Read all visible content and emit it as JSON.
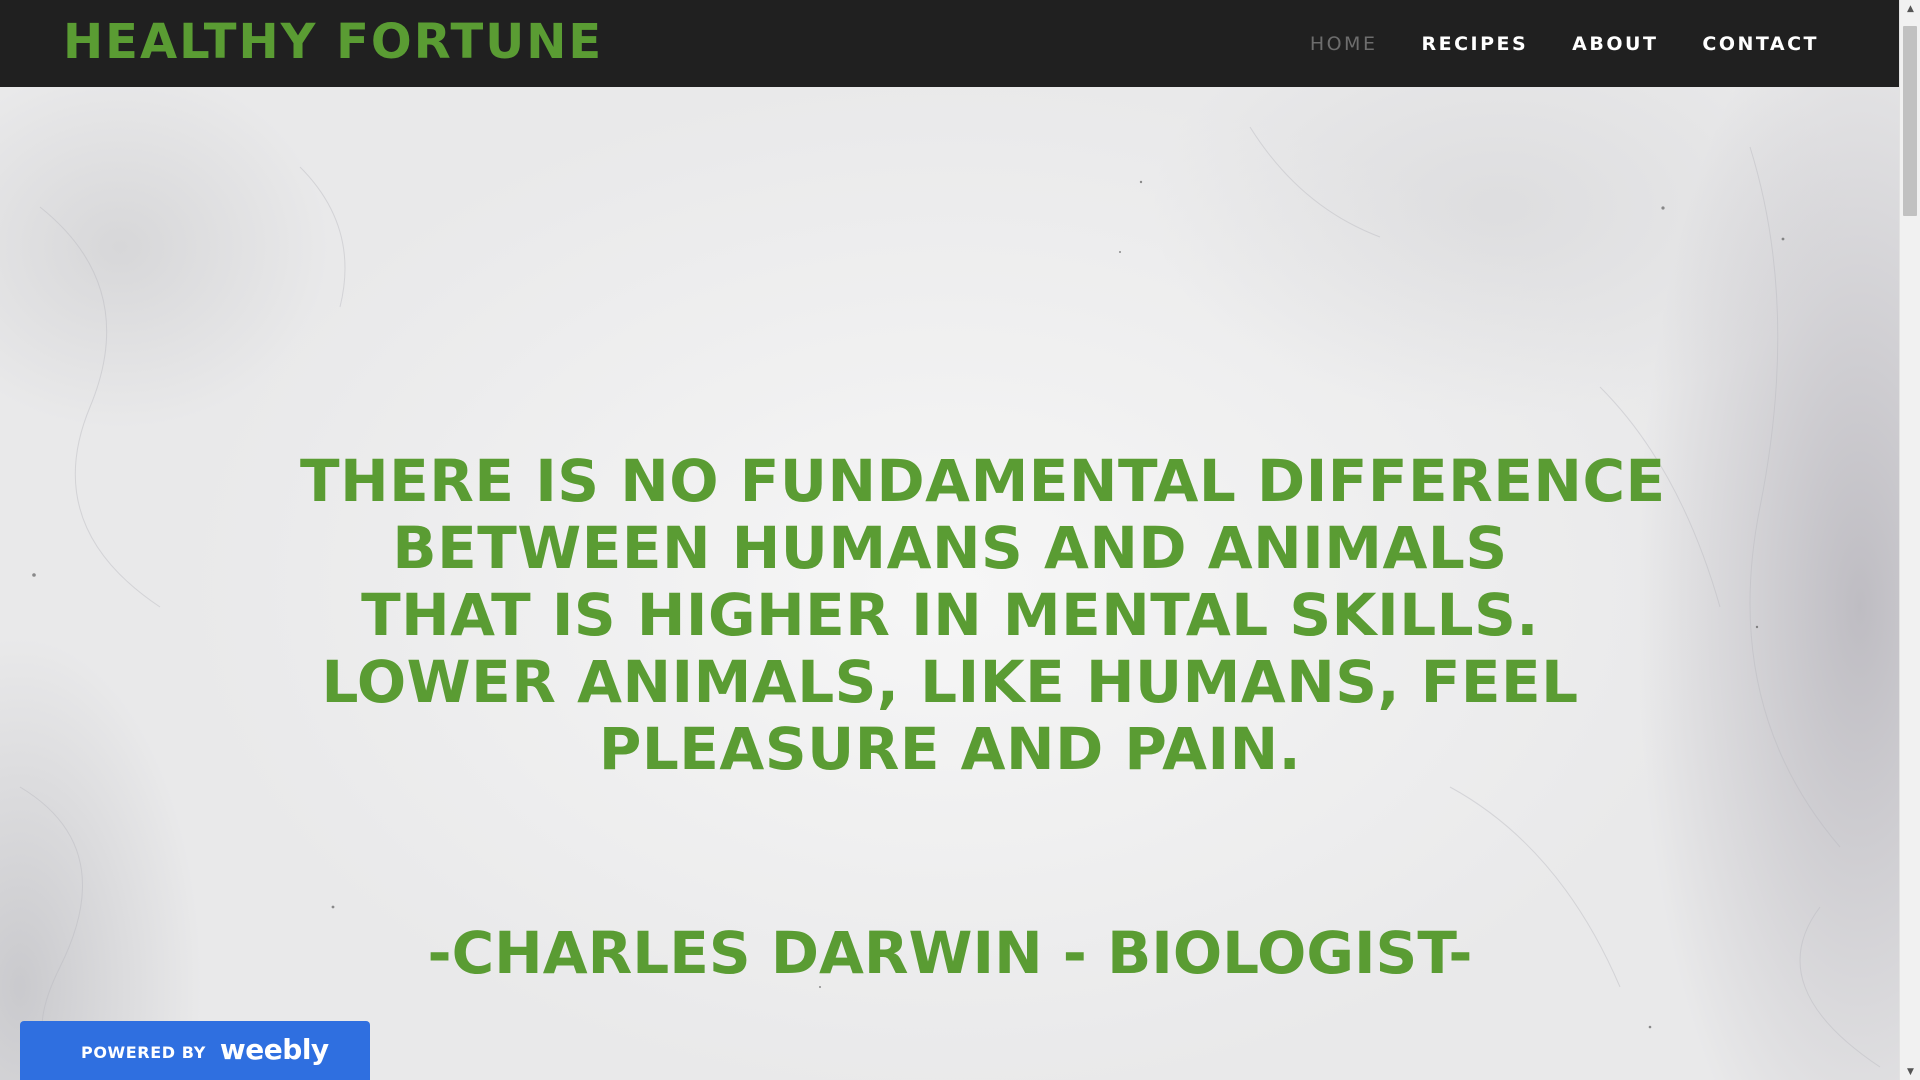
{
  "header": {
    "site_title": "HEALTHY FORTUNE",
    "nav": [
      {
        "label": "HOME",
        "active": true
      },
      {
        "label": "RECIPES",
        "active": false
      },
      {
        "label": "ABOUT",
        "active": false
      },
      {
        "label": "CONTACT",
        "active": false
      }
    ]
  },
  "hero": {
    "quote_lines": [
      "THERE IS NO FUNDAMENTAL DIFFERENCE",
      "BETWEEN HUMANS AND ANIMALS",
      "THAT IS HIGHER IN MENTAL SKILLS.",
      "LOWER ANIMALS, LIKE HUMANS, FEEL",
      "PLEASURE AND PAIN."
    ],
    "attribution": "-CHARLES DARWIN - BIOLOGIST-"
  },
  "badge": {
    "label": "POWERED BY",
    "logo_text": "weebly"
  },
  "colors": {
    "accent_green": "#5a9c33",
    "header_bg": "#202020",
    "nav_active": "#6d6d6d",
    "badge_blue": "#2f6fe0"
  },
  "icons": {
    "scroll_up": "scroll-up-arrow-icon",
    "scroll_down": "scroll-down-arrow-icon"
  }
}
